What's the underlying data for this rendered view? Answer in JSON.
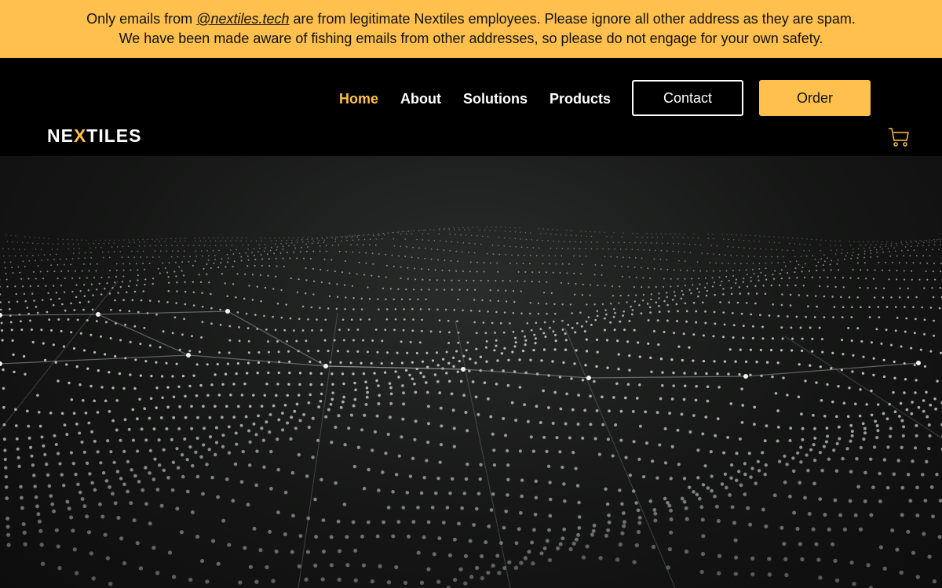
{
  "notice": {
    "line1_before": "Only emails from ",
    "email_link": "@nextiles.tech",
    "line1_after": " are from legitimate Nextiles employees. Please ignore all other address as they are spam.",
    "line2": "We have been made aware of fishing emails from other addresses, so please do not engage for your own safety."
  },
  "header": {
    "logo": {
      "part1": "NE",
      "part2": "X",
      "part3": "TILES"
    },
    "nav": [
      {
        "label": "Home",
        "active": true
      },
      {
        "label": "About"
      },
      {
        "label": "Solutions"
      },
      {
        "label": "Products"
      }
    ],
    "contact_label": "Contact",
    "order_label": "Order",
    "cart_icon": "cart-icon"
  },
  "colors": {
    "accent": "#ffc04d",
    "background": "#000000"
  }
}
